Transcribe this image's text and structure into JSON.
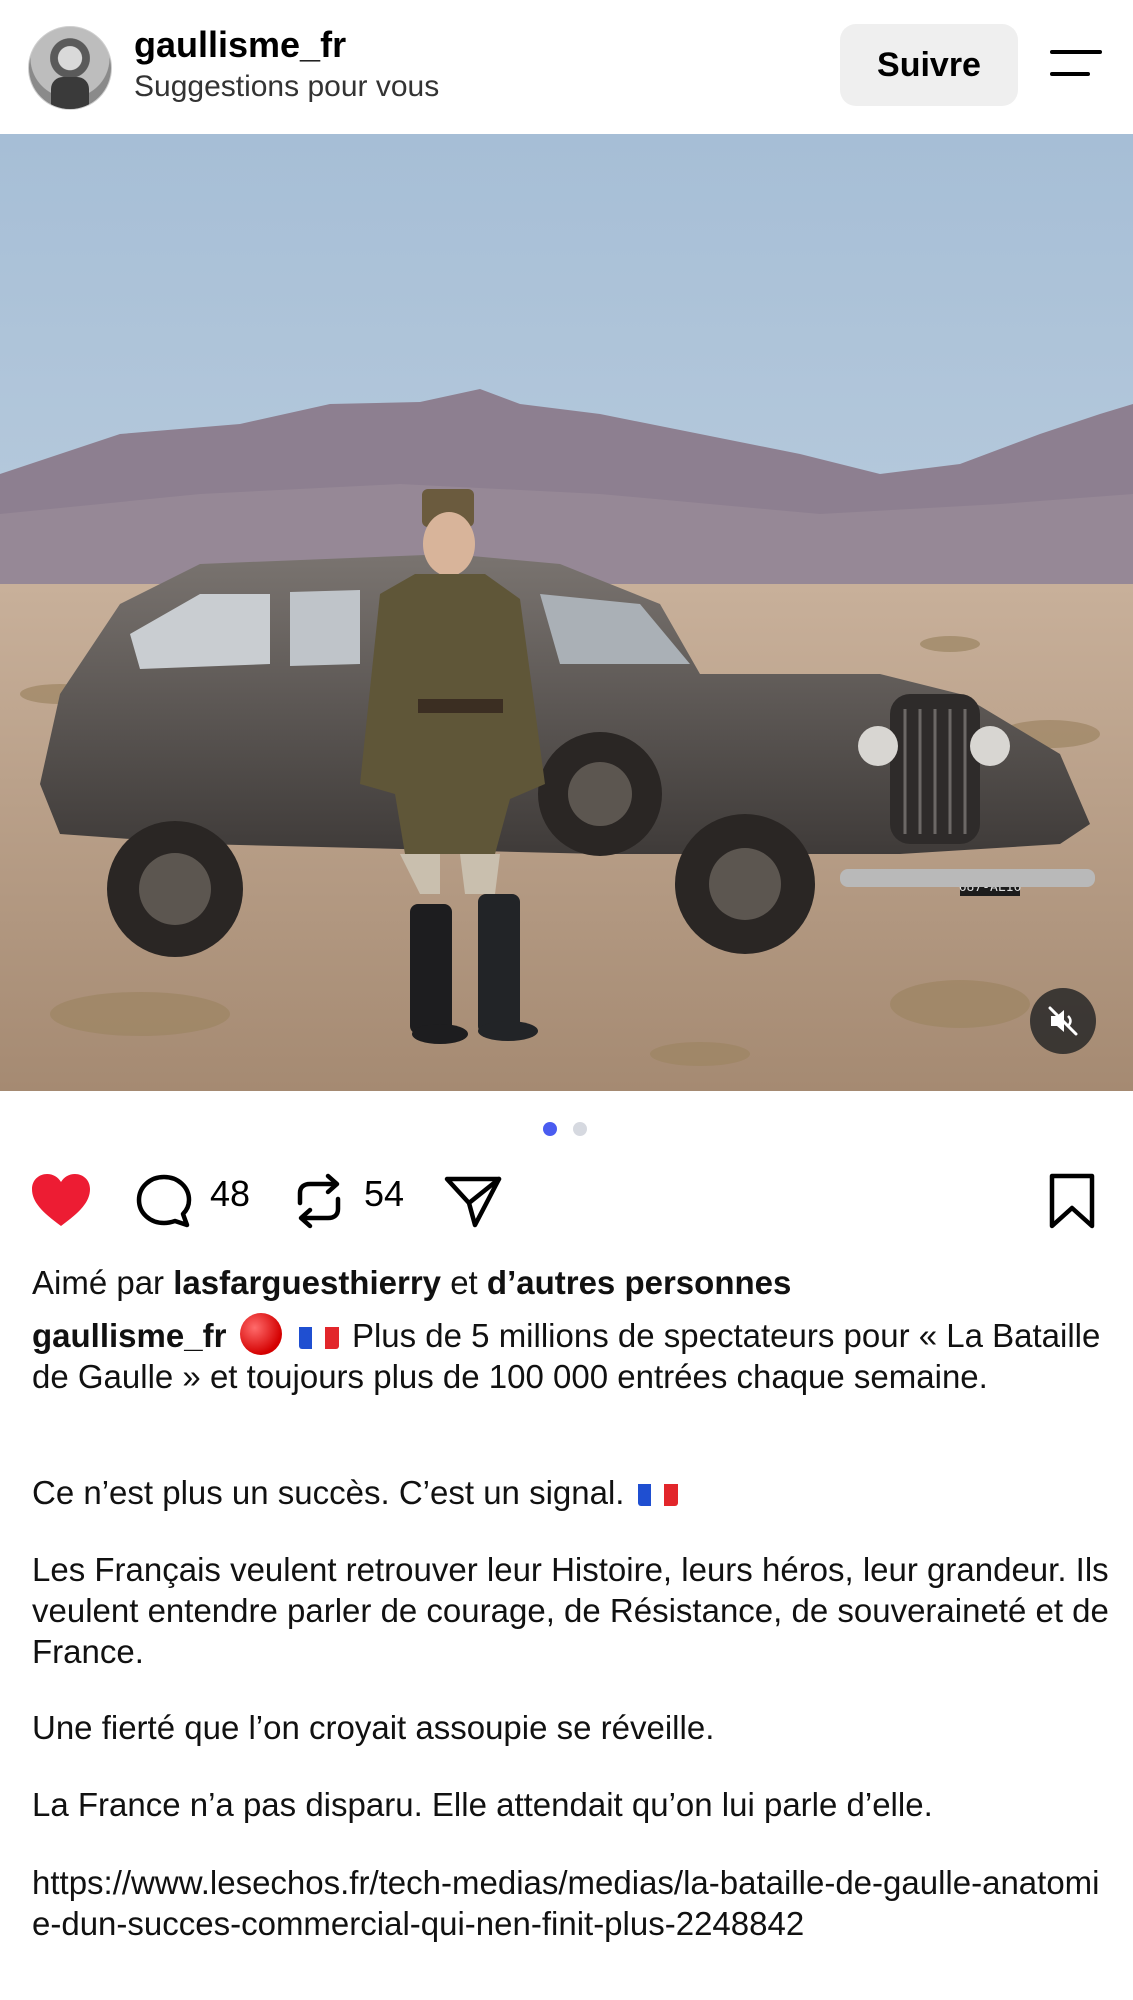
{
  "header": {
    "username": "gaullisme_fr",
    "subtitle": "Suggestions pour vous",
    "follow_label": "Suivre"
  },
  "media": {
    "plate_text": "687-AL16",
    "carousel_count": 2,
    "carousel_active": 1
  },
  "actions": {
    "comments": "48",
    "reposts": "54",
    "like_color": "#ed1c33"
  },
  "likes": {
    "prefix": "Aimé par",
    "user": "lasfarguesthierry",
    "connector": "et",
    "others": "d’autres personnes"
  },
  "caption": {
    "author": "gaullisme_fr",
    "line1": "Plus de 5 millions de spectateurs pour « La Bataille de Gaulle » et toujours plus de 100 000 entrées chaque semaine.",
    "line2": "Ce n’est plus un succès. C’est un signal.",
    "line3": "Les Français veulent retrouver leur Histoire, leurs héros, leur grandeur. Ils veulent entendre parler de courage, de Résistance, de souveraineté et de France.",
    "line4": "Une fierté que l’on croyait assoupie se réveille.",
    "line5": "La France n’a pas disparu. Elle attendait qu’on lui parle d’elle.",
    "link": "https://www.lesechos.fr/tech-medias/medias/la-bataille-de-gaulle-anatomie-dun-succes-commercial-qui-nen-finit-plus-2248842"
  },
  "colors": {
    "accent_dot": "#4a5cf0",
    "inactive_dot": "#d6d9e0",
    "follow_bg": "#efefef"
  }
}
